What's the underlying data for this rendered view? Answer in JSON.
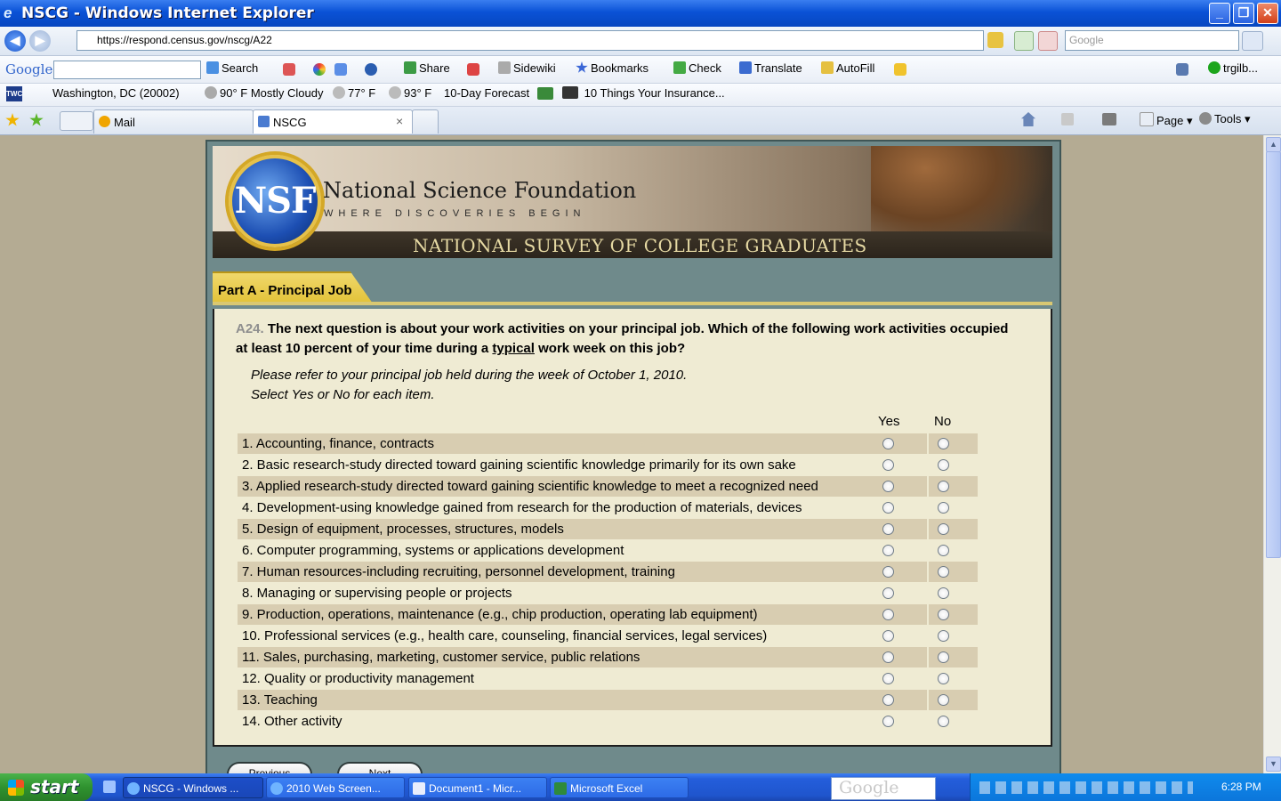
{
  "window": {
    "title": "NSCG - Windows Internet Explorer",
    "ie_glyph": "e",
    "min_glyph": "_",
    "max_glyph": "❐",
    "close_glyph": "✕"
  },
  "address_bar": {
    "back_glyph": "◀",
    "fwd_glyph": "▶",
    "url": "https://respond.census.gov/nscg/A22",
    "search_placeholder": "Google"
  },
  "google_toolbar": {
    "logo": "Google",
    "items": [
      "Search",
      "Share",
      "Sidewiki",
      "Bookmarks",
      "Check",
      "Translate",
      "AutoFill"
    ],
    "user": "trgilb..."
  },
  "weather_toolbar": {
    "brand": "TWC",
    "location": "Washington, DC (20002)",
    "current": "90° F Mostly Cloudy",
    "temp2": "77° F",
    "temp3": "93° F",
    "forecast": "10-Day Forecast",
    "news": "10 Things Your Insurance..."
  },
  "tabs": {
    "mail": "Mail",
    "nscg": "NSCG",
    "close_glyph": "×",
    "commands": [
      "Page",
      "Tools"
    ]
  },
  "banner": {
    "logo_text": "NSF",
    "org": "National Science Foundation",
    "tagline": "WHERE DISCOVERIES BEGIN",
    "survey": "NATIONAL SURVEY OF COLLEGE GRADUATES"
  },
  "section": {
    "part": "Part A - Principal Job"
  },
  "question": {
    "number": "A24.",
    "text_before": "The next question is about your work activities on your principal job. Which of the following work activities occupied at least 10 percent of your time during a",
    "underlined": "typical",
    "text_after": "work week on this job?",
    "instruction1": "Please refer to your principal job held during the week of October 1, 2010.",
    "instruction2": "Select Yes or No for each item.",
    "yes_label": "Yes",
    "no_label": "No",
    "items": [
      "1. Accounting, finance, contracts",
      "2. Basic research-study directed toward gaining scientific knowledge primarily for its own sake",
      "3. Applied research-study directed toward gaining scientific knowledge to meet a recognized need",
      "4. Development-using knowledge gained from research for the production of materials, devices",
      "5. Design of equipment, processes, structures, models",
      "6. Computer programming, systems or applications development",
      "7. Human resources-including recruiting, personnel development, training",
      "8. Managing or supervising people or projects",
      "9. Production, operations, maintenance (e.g., chip production, operating lab equipment)",
      "10. Professional services (e.g., health care, counseling, financial services, legal services)",
      "11. Sales, purchasing, marketing, customer service, public relations",
      "12. Quality or productivity management",
      "13. Teaching",
      "14. Other activity"
    ]
  },
  "nav": {
    "previous": "Previous",
    "next": "Next"
  },
  "taskbar": {
    "start": "start",
    "tasks": [
      "NSCG - Windows ...",
      "2010 Web Screen...",
      "Document1 - Micr...",
      "Microsoft Excel"
    ],
    "google_box": "Google",
    "clock": "6:28 PM"
  }
}
